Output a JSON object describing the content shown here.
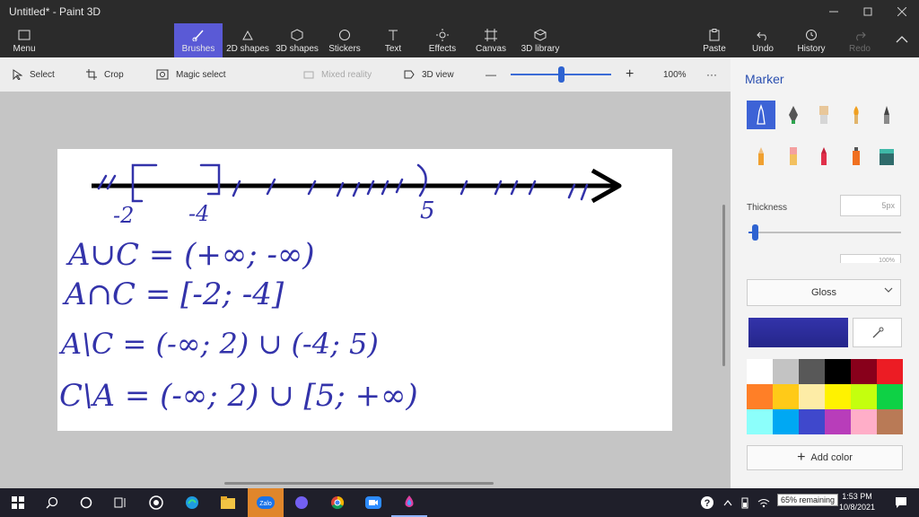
{
  "window": {
    "title": "Untitled* - Paint 3D"
  },
  "ribbon": {
    "menu": "Menu",
    "tools": [
      {
        "id": "brushes",
        "label": "Brushes"
      },
      {
        "id": "shapes2d",
        "label": "2D shapes"
      },
      {
        "id": "shapes3d",
        "label": "3D shapes"
      },
      {
        "id": "stickers",
        "label": "Stickers"
      },
      {
        "id": "text",
        "label": "Text"
      },
      {
        "id": "effects",
        "label": "Effects"
      },
      {
        "id": "canvas",
        "label": "Canvas"
      },
      {
        "id": "library3d",
        "label": "3D library"
      }
    ],
    "paste": "Paste",
    "undo": "Undo",
    "history": "History",
    "redo": "Redo",
    "active_tool": "Brushes"
  },
  "toolbar": {
    "select": "Select",
    "crop": "Crop",
    "magic_select": "Magic select",
    "mixed_reality": "Mixed reality",
    "view3d": "3D view",
    "zoom_minus": "—",
    "zoom_plus": "+",
    "zoom_level": "100%",
    "zoom_fraction": 0.5,
    "more": "···"
  },
  "panel": {
    "title": "Marker",
    "thickness_label": "Thickness",
    "thickness_value": "5px",
    "opacity_value": "100%",
    "finish": "Gloss",
    "add_color": "Add color",
    "current_color": "#3333aa",
    "palette": [
      "#ffffff",
      "#c3c3c3",
      "#585858",
      "#000000",
      "#88001b",
      "#ec1c24",
      "#ff7f27",
      "#ffca18",
      "#fdeca6",
      "#fff200",
      "#c4ff0e",
      "#0ed145",
      "#8cfffb",
      "#00a8f3",
      "#3f48cc",
      "#b83dba",
      "#ffaec8",
      "#b97a56"
    ],
    "brushes": [
      "marker-icon",
      "calligraphy-pen-icon",
      "oil-brush-icon",
      "watercolor-icon",
      "pixel-pen-icon",
      "pencil-icon",
      "eraser-icon",
      "crayon-icon",
      "spray-can-icon",
      "fill-bucket-icon"
    ]
  },
  "drawing": {
    "ink_color": "#3333aa",
    "labels": {
      "tick_left": "-2",
      "tick_mid": "-4",
      "tick_right": "5"
    },
    "lines": [
      "A∪C = (+∞; -∞)",
      "A∩C = [-2; -4]",
      "A\\C = (-∞; 2) ∪ (-4; 5)",
      "C\\A = (-∞; 2) ∪ [5; +∞)"
    ]
  },
  "taskbar": {
    "tooltip": "65% remaining",
    "time": "1:53 PM",
    "date": "10/8/2021"
  }
}
